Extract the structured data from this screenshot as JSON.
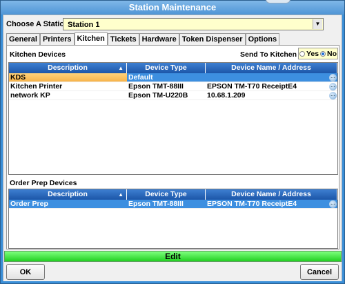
{
  "window": {
    "title": "Station Maintenance"
  },
  "station": {
    "label": "Choose A Station",
    "value": "Station 1"
  },
  "tabs": [
    {
      "label": "General"
    },
    {
      "label": "Printers"
    },
    {
      "label": "Kitchen",
      "active": true
    },
    {
      "label": "Tickets"
    },
    {
      "label": "Hardware"
    },
    {
      "label": "Token Dispenser"
    },
    {
      "label": "Options"
    }
  ],
  "kitchen_devices": {
    "title": "Kitchen Devices",
    "send_to_kitchen": {
      "label": "Send To Kitchen",
      "options": [
        "Yes",
        "No"
      ],
      "selected": "No"
    },
    "columns": [
      "Description",
      "Device Type",
      "Device Name / Address"
    ],
    "rows": [
      [
        "KDS",
        "Default",
        ""
      ],
      [
        "Kitchen Printer",
        "Epson TMT-88III",
        "EPSON TM-T70 ReceiptE4"
      ],
      [
        "network KP",
        "Epson TM-U220B",
        "10.68.1.209"
      ]
    ]
  },
  "order_prep_devices": {
    "title": "Order Prep Devices",
    "columns": [
      "Description",
      "Device Type",
      "Device Name / Address"
    ],
    "rows": [
      [
        "Order Prep",
        "Epson TMT-88III",
        "EPSON TM-T70 ReceiptE4"
      ]
    ]
  },
  "edit_bar": {
    "label": "Edit"
  },
  "buttons": {
    "ok": "OK",
    "cancel": "Cancel"
  },
  "colors": {
    "accent": "#3d8fe0",
    "edit_green": "#22d022",
    "field_yellow": "#ffffcc"
  }
}
